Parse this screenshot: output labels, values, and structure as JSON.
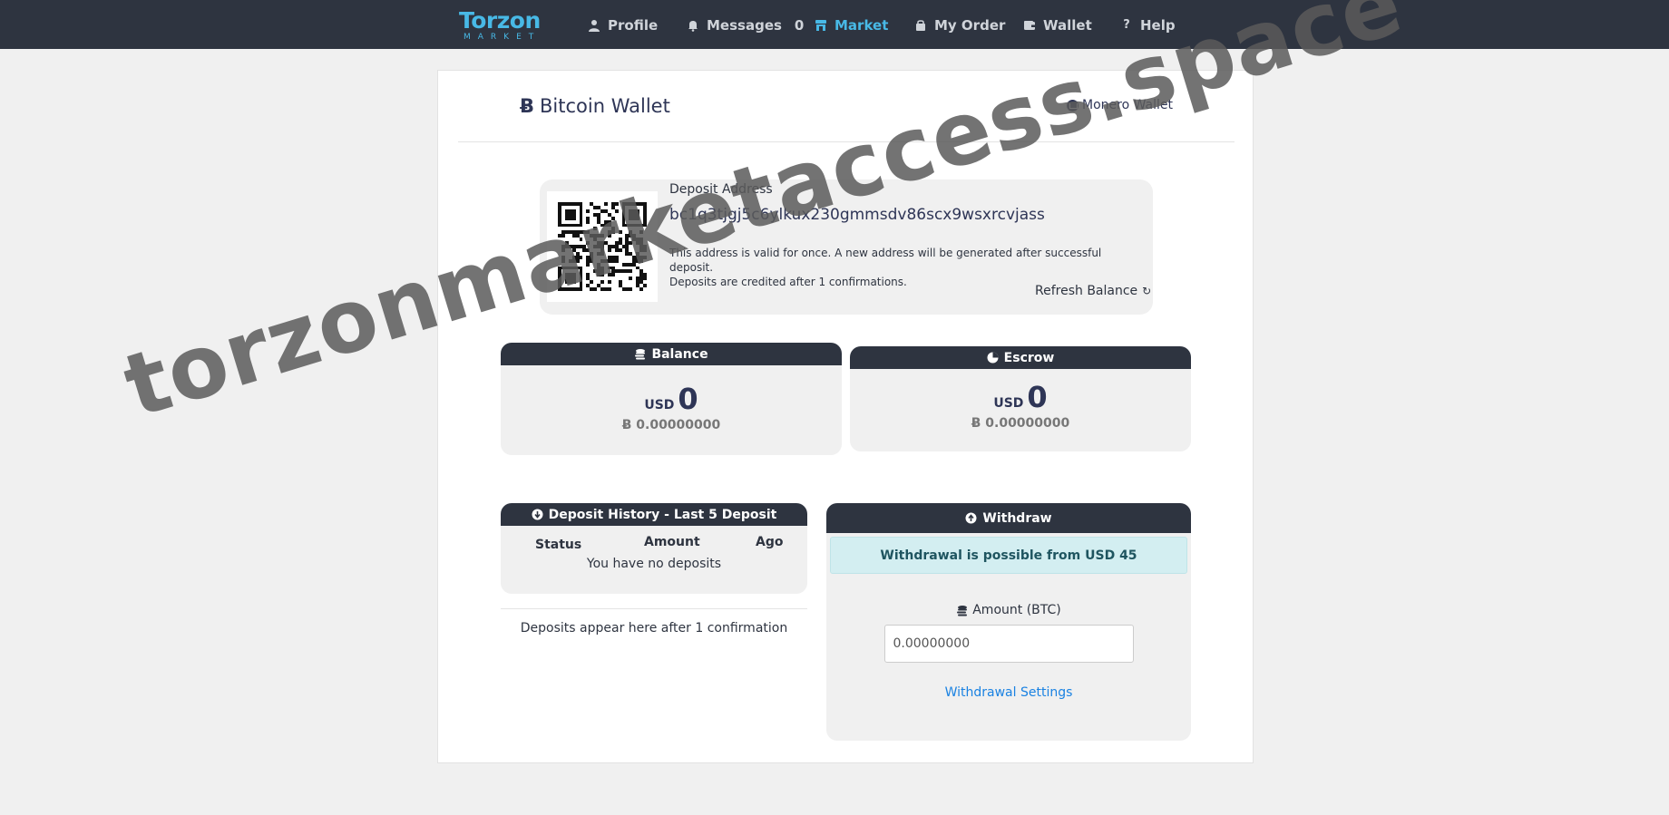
{
  "nav": {
    "logo_main": "Torzon",
    "logo_sub": "MARKET",
    "profile": "Profile",
    "messages": "Messages",
    "messages_count": "0",
    "market": "Market",
    "my_order": "My Order",
    "wallet": "Wallet",
    "help": "Help",
    "accent": "#48b9e6"
  },
  "wallet": {
    "title": "Bitcoin Wallet",
    "btc_symbol": "Ƀ",
    "monero_link": "Monero Wallet"
  },
  "deposit": {
    "label": "Deposit Address",
    "address": "bc1q3tjgj5c6ylkux230gmmsdv86scx9wsxrcvjass",
    "note_line1": "This address is valid for once. A new address will be generated after successful deposit.",
    "note_line2": "Deposits are credited after 1 confirmations.",
    "refresh": "Refresh Balance",
    "refresh_icon": "↻"
  },
  "balance": {
    "title": "Balance",
    "currency": "USD",
    "usd_value": "0",
    "btc_value": "Ƀ 0.00000000"
  },
  "escrow": {
    "title": "Escrow",
    "currency": "USD",
    "usd_value": "0",
    "btc_value": "Ƀ 0.00000000"
  },
  "history": {
    "title": "Deposit History - Last 5 Deposit",
    "col_status": "Status",
    "col_amount": "Amount",
    "col_ago": "Ago",
    "empty": "You have no deposits",
    "note": "Deposits appear here after 1 confirmation"
  },
  "withdraw": {
    "title": "Withdraw",
    "alert": "Withdrawal is possible from USD 45",
    "amount_label": "Amount (BTC)",
    "amount_value": "0.00000000",
    "settings_link": "Withdrawal Settings"
  },
  "watermark": "torzonmarketaccess.space"
}
